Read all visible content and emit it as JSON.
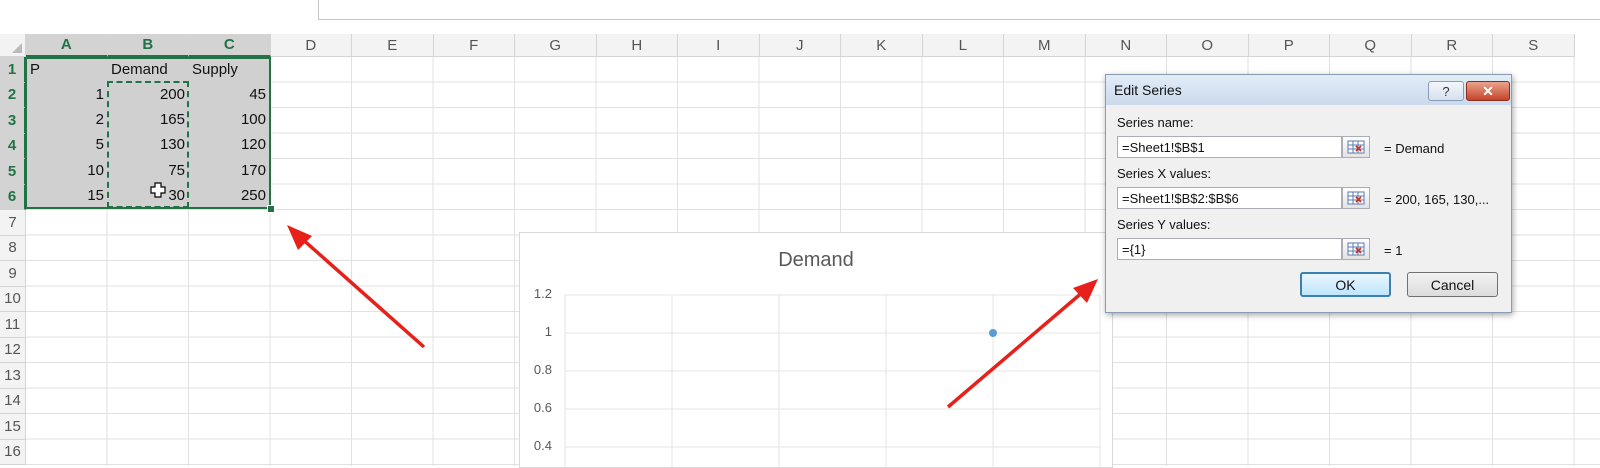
{
  "sheet": {
    "columns": [
      "A",
      "B",
      "C",
      "D",
      "E",
      "F",
      "G",
      "H",
      "I",
      "J",
      "K",
      "L",
      "M",
      "N",
      "O",
      "P",
      "Q",
      "R",
      "S"
    ],
    "rows": [
      "1",
      "2",
      "3",
      "4",
      "5",
      "6",
      "7",
      "8",
      "9",
      "10",
      "11",
      "12",
      "13",
      "14",
      "15",
      "16"
    ],
    "cells": {
      "a1": "P",
      "b1": "Demand",
      "c1": "Supply",
      "a2": "1",
      "b2": "200",
      "c2": "45",
      "a3": "2",
      "b3": "165",
      "c3": "100",
      "a4": "5",
      "b4": "130",
      "c4": "120",
      "a5": "10",
      "b5": "75",
      "c5": "170",
      "a6": "15",
      "b6": "30",
      "c6": "250"
    }
  },
  "chart": {
    "title": "Demand",
    "y_ticks": [
      "1.2",
      "1",
      "0.8",
      "0.6",
      "0.4"
    ]
  },
  "chart_data": {
    "type": "scatter",
    "title": "Demand",
    "series": [
      {
        "name": "Demand",
        "points": [
          {
            "x": 200,
            "y": 1
          }
        ]
      }
    ],
    "y_tick_labels": [
      "1.2",
      "1",
      "0.8",
      "0.6",
      "0.4"
    ],
    "grid": true,
    "point_color": "#5b9bd5"
  },
  "dialog": {
    "title": "Edit Series",
    "help": "?",
    "close": "✕",
    "series_name_label": "Series name:",
    "series_name_value": "=Sheet1!$B$1",
    "series_name_preview": "= Demand",
    "series_x_label": "Series X values:",
    "series_x_value": "=Sheet1!$B$2:$B$6",
    "series_x_preview": "= 200, 165, 130,...",
    "series_y_label": "Series Y values:",
    "series_y_value": "={1}",
    "series_y_preview": "= 1",
    "ok": "OK",
    "cancel": "Cancel"
  },
  "colors": {
    "accent": "#217346",
    "arrow": "#e8201a",
    "marker": "#5b9bd5"
  }
}
